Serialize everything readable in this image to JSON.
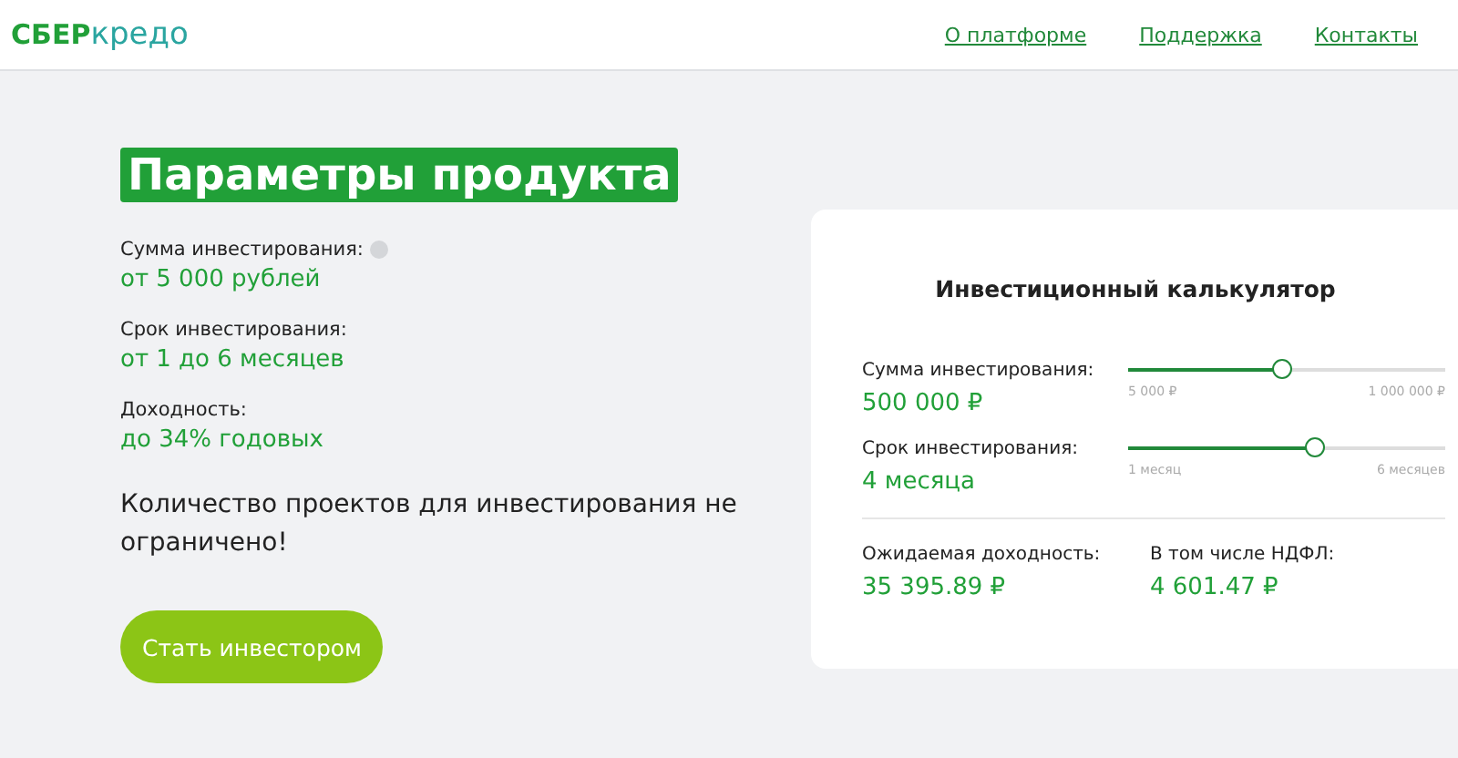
{
  "header": {
    "logo": [
      "СБЕР",
      "кредо"
    ],
    "nav": [
      {
        "label": "О платформе"
      },
      {
        "label": "Поддержка"
      },
      {
        "label": "Контакты"
      }
    ]
  },
  "product": {
    "title": "Параметры продукта",
    "params": [
      {
        "label": "Сумма инвестирования:",
        "value": "от 5 000 рублей",
        "info": true
      },
      {
        "label": "Срок инвестирования:",
        "value": "от 1 до 6 месяцев",
        "info": false
      },
      {
        "label": "Доходность:",
        "value": "до 34% годовых",
        "info": false
      }
    ],
    "note": "Количество проектов для инвестирования не ограничено!",
    "button": "Стать инвестором"
  },
  "calculator": {
    "title": "Инвестиционный калькулятор",
    "sliders": [
      {
        "label": "Сумма инвестирования:",
        "value": "500 000 ₽",
        "level": 0.49,
        "min": "5 000 ₽",
        "max": "1 000 000 ₽"
      },
      {
        "label": "Срок инвестирования:",
        "value": "4 месяца",
        "level": 0.59,
        "min": "1 месяц",
        "max": "6 месяцев"
      }
    ],
    "results": [
      {
        "label": "Ожидаемая доходность:",
        "value": "35 395.89 ₽"
      },
      {
        "label": "В том числе НДФЛ:",
        "value": "4 601.47 ₽"
      }
    ]
  }
}
